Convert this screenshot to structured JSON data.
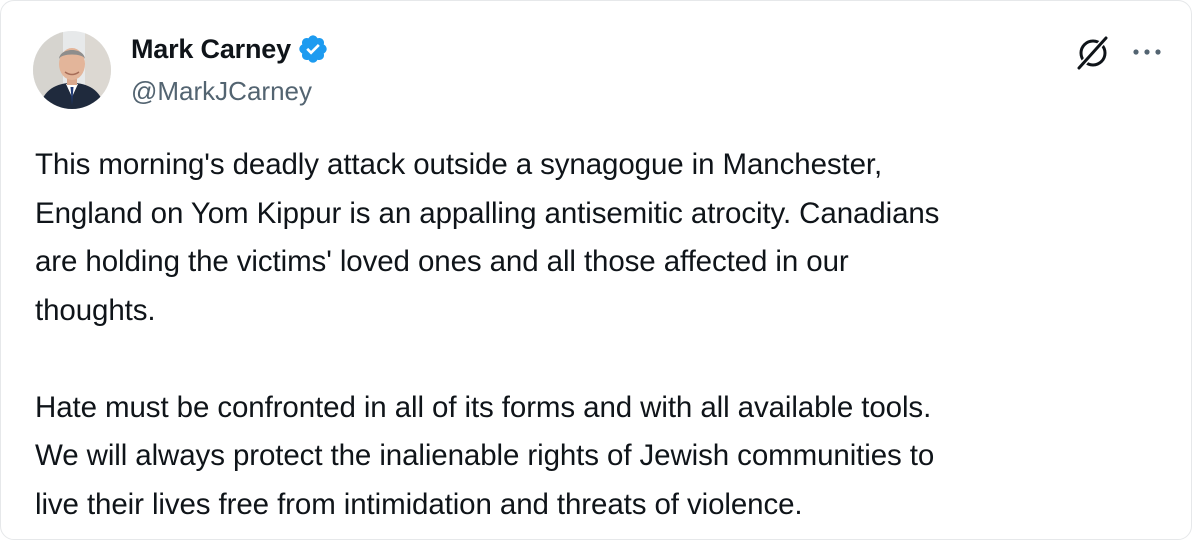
{
  "post": {
    "author": {
      "display_name": "Mark Carney",
      "handle": "@MarkJCarney",
      "verified": true,
      "verified_color": "#1d9bf0"
    },
    "actions": {
      "grok_icon": "grok-icon",
      "more_icon": "more-options-icon"
    },
    "text": {
      "paragraph1": [
        "This morning's deadly attack outside a synagogue in Manchester,",
        "England on Yom Kippur is an appalling antisemitic atrocity. Canadians",
        "are holding the victims' loved ones and all those affected in our",
        "thoughts."
      ],
      "paragraph2": [
        "Hate must be confronted in all of its forms and with all available tools.",
        "We will always protect the inalienable rights of Jewish communities to",
        "live their lives free from intimidation and threats of violence."
      ]
    }
  },
  "colors": {
    "text_primary": "#0f1419",
    "text_secondary": "#536471",
    "border": "#e6e8ea"
  }
}
